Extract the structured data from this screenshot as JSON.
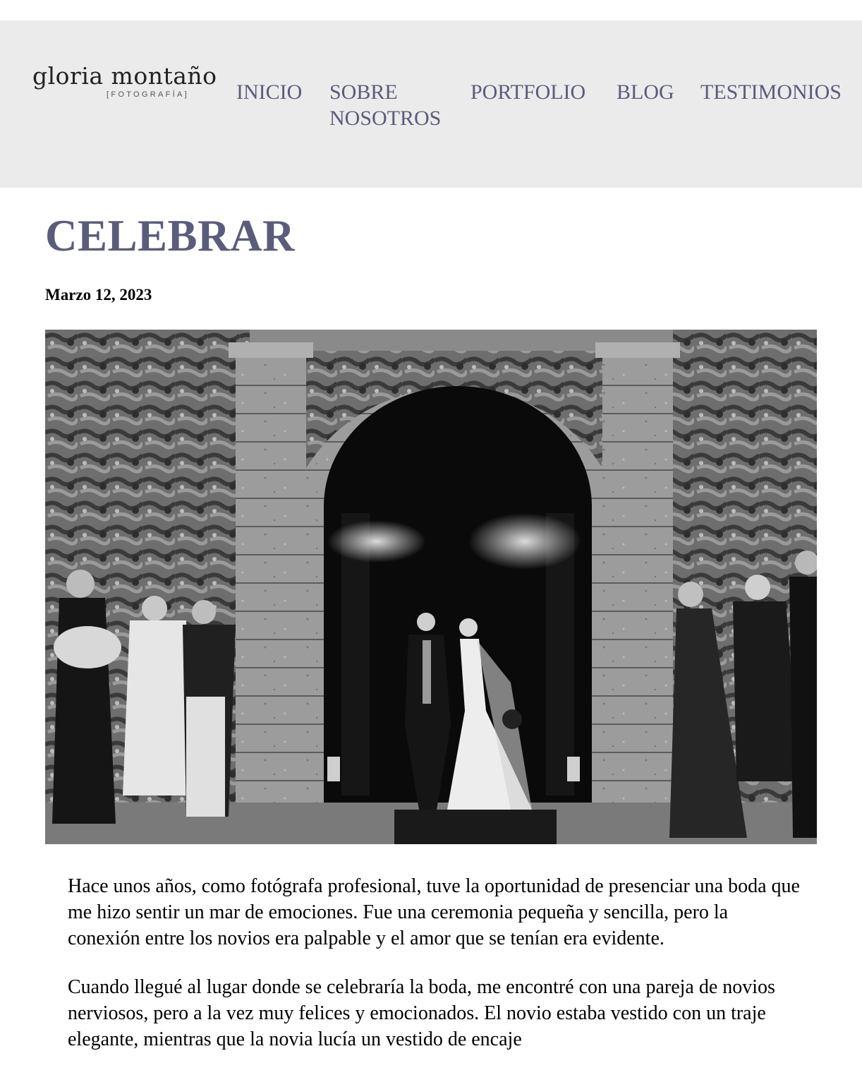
{
  "header": {
    "logo": {
      "name": "gloria montaño",
      "subtitle": "[FOTOGRAFÍA]"
    },
    "nav": [
      {
        "label": "INICIO"
      },
      {
        "label": "SOBRE NOSOTROS"
      },
      {
        "label": "PORTFOLIO"
      },
      {
        "label": "BLOG"
      },
      {
        "label": "TESTIMONIOS"
      }
    ]
  },
  "post": {
    "title": "CELEBRAR",
    "date": "Marzo 12, 2023",
    "paragraphs": [
      "Hace unos años, como fotógrafa profesional, tuve la oportunidad de presenciar una boda que me hizo sentir un mar de emociones. Fue una ceremonia pequeña y sencilla, pero la conexión entre los novios era palpable y el amor que se tenían era evidente.",
      "Cuando llegué al lugar donde se celebraría la boda, me encontré con una pareja de novios nerviosos, pero a la vez muy felices y emocionados. El novio estaba vestido con un traje elegante, mientras que la novia lucía un vestido de encaje"
    ]
  },
  "colors": {
    "accent": "#5a5c7a",
    "header_bg": "#ebebeb"
  }
}
